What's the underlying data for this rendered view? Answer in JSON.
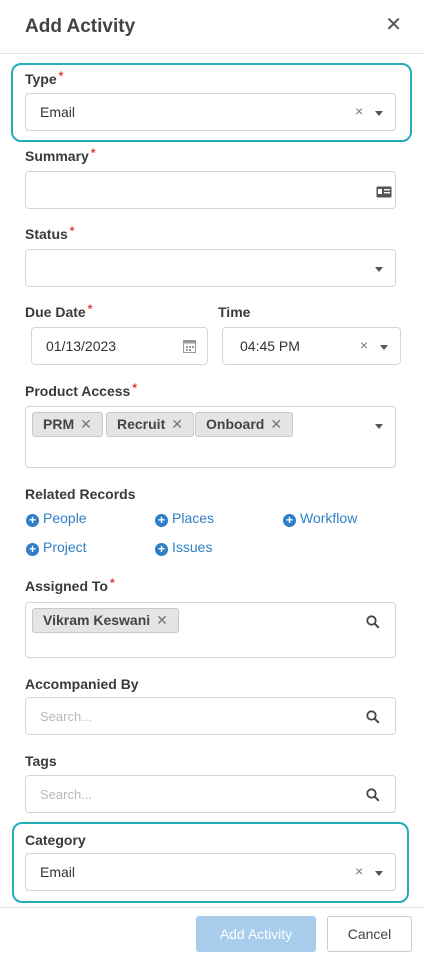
{
  "header": {
    "title": "Add Activity",
    "close_glyph": "✕"
  },
  "required_mark": "*",
  "clear_glyph": "×",
  "remove_glyph": "✕",
  "type": {
    "label": "Type",
    "value": "Email"
  },
  "summary": {
    "label": "Summary",
    "value": ""
  },
  "status": {
    "label": "Status",
    "value": ""
  },
  "due_date": {
    "label": "Due Date",
    "value": "01/13/2023"
  },
  "time": {
    "label": "Time",
    "value": "04:45 PM"
  },
  "product_access": {
    "label": "Product Access",
    "chips": [
      "PRM",
      "Recruit",
      "Onboard"
    ]
  },
  "related_records": {
    "label": "Related Records",
    "links": [
      "People",
      "Places",
      "Workflow",
      "Project",
      "Issues"
    ],
    "plus_glyph": "+"
  },
  "assigned_to": {
    "label": "Assigned To",
    "chips": [
      "Vikram Keswani"
    ]
  },
  "accompanied_by": {
    "label": "Accompanied By",
    "placeholder": "Search..."
  },
  "tags": {
    "label": "Tags",
    "placeholder": "Search..."
  },
  "category": {
    "label": "Category",
    "value": "Email"
  },
  "buttons": {
    "submit": "Add Activity",
    "cancel": "Cancel"
  },
  "colors": {
    "highlight": "#21aeb8",
    "link": "#2f7fc6",
    "required": "#e23a3a",
    "submit_bg": "#a7ccec"
  }
}
